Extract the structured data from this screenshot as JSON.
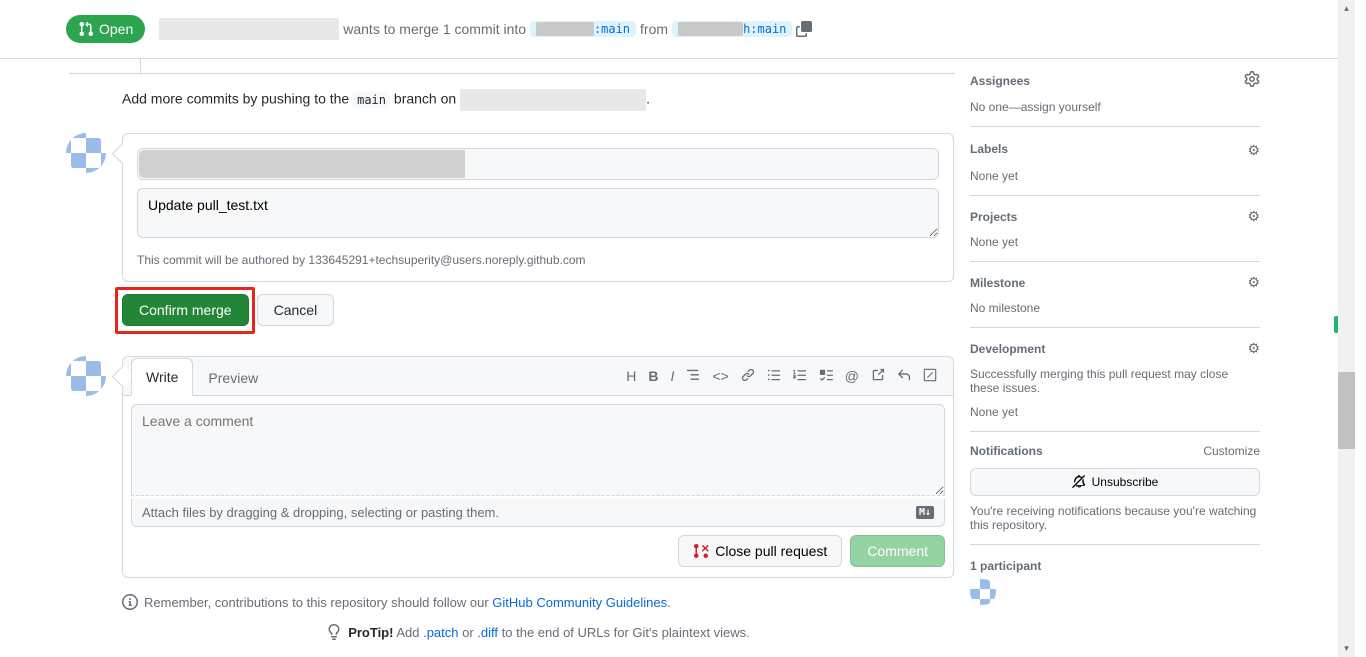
{
  "header": {
    "status": "Open",
    "merge_text_1": "wants to merge 1 commit into",
    "branch_into_suffix": ":main",
    "from_text": "from",
    "branch_from_suffix": "h:main"
  },
  "push_hint": {
    "prefix": "Add more commits by pushing to the ",
    "branch": "main",
    "mid": " branch on "
  },
  "merge": {
    "body": "Update pull_test.txt",
    "author_note": "This commit will be authored by 133645291+techsuperity@users.noreply.github.com",
    "confirm": "Confirm merge",
    "cancel": "Cancel"
  },
  "comment": {
    "tab_write": "Write",
    "tab_preview": "Preview",
    "placeholder": "Leave a comment",
    "attach_hint": "Attach files by dragging & dropping, selecting or pasting them.",
    "close_pr": "Close pull request",
    "comment_btn": "Comment"
  },
  "remember": {
    "text_before": "Remember, contributions to this repository should follow our ",
    "link": "GitHub Community Guidelines",
    "text_after": "."
  },
  "protip": {
    "label": "ProTip!",
    "before": " Add ",
    "patch": ".patch",
    "or": " or ",
    "diff": ".diff",
    "after": " to the end of URLs for Git's plaintext views."
  },
  "sidebar": {
    "assignees": {
      "title": "Assignees",
      "body_before": "No one—",
      "link": "assign yourself"
    },
    "labels": {
      "title": "Labels",
      "body": "None yet"
    },
    "projects": {
      "title": "Projects",
      "body": "None yet"
    },
    "milestone": {
      "title": "Milestone",
      "body": "No milestone"
    },
    "development": {
      "title": "Development",
      "hint": "Successfully merging this pull request may close these issues.",
      "body": "None yet"
    },
    "notifications": {
      "title": "Notifications",
      "customize": "Customize",
      "unsubscribe": "Unsubscribe",
      "note": "You're receiving notifications because you're watching this repository."
    },
    "participants": {
      "title": "1 participant"
    }
  }
}
